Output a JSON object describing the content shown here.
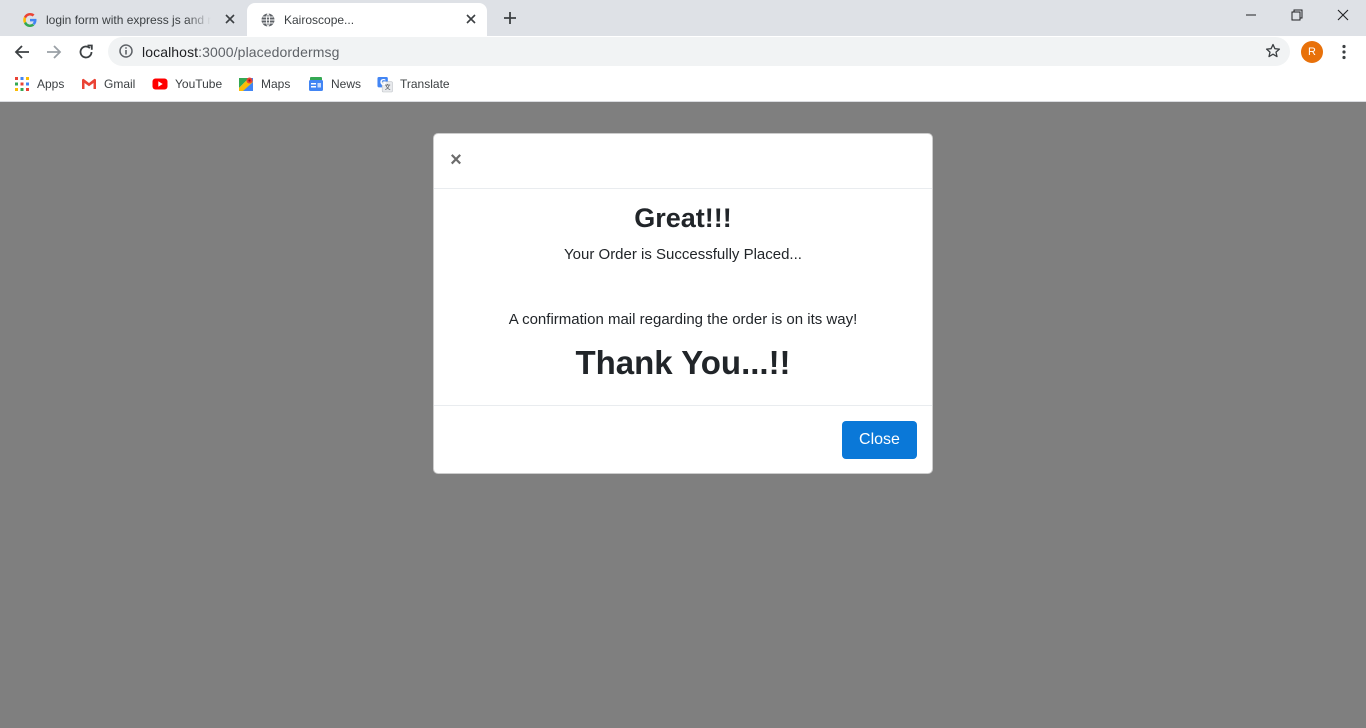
{
  "browser": {
    "tabs": [
      {
        "title": "login form with express js and mysql",
        "favicon": "google-g-icon",
        "active": false
      },
      {
        "title": "Kairoscope...",
        "favicon": "globe-icon",
        "active": true
      }
    ],
    "url": {
      "host": "localhost",
      "path": ":3000/placedordermsg"
    },
    "profile_initial": "R",
    "bookmarks": [
      {
        "label": "Apps",
        "icon": "apps-grid-icon"
      },
      {
        "label": "Gmail",
        "icon": "gmail-icon"
      },
      {
        "label": "YouTube",
        "icon": "youtube-icon"
      },
      {
        "label": "Maps",
        "icon": "maps-icon"
      },
      {
        "label": "News",
        "icon": "news-icon"
      },
      {
        "label": "Translate",
        "icon": "translate-icon"
      }
    ]
  },
  "modal": {
    "close_symbol": "×",
    "title": "Great!!!",
    "subtitle": "Your Order is Successfully Placed...",
    "info": "A confirmation mail regarding the order is on its way!",
    "thanks": "Thank You...!!",
    "close_button": "Close"
  },
  "colors": {
    "overlay": "#7f7f7f",
    "primary_button": "#0a78d8",
    "profile_avatar": "#e8710a"
  }
}
